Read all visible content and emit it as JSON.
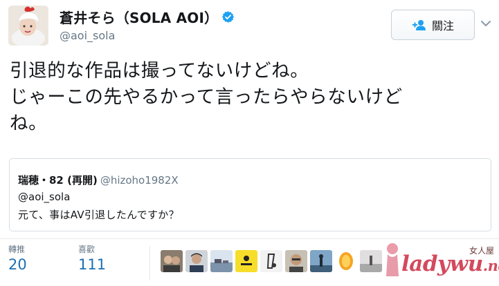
{
  "user": {
    "display_name": "蒼井そら（SOLA AOI）",
    "handle": "@aoi_sola",
    "verified_icon": "verified-badge-icon",
    "avatar_icon": "profile-avatar"
  },
  "follow": {
    "label": "關注",
    "icon": "add-user-icon"
  },
  "tweet": {
    "lines": [
      "引退的な作品は撮ってないけどね。",
      "じゃーこの先やるかって言ったらやらないけど",
      "ね。"
    ]
  },
  "quote": {
    "name": "瑞穂・82 (再開)",
    "handle": "@hizoho1982X",
    "mention": "@aoi_sola",
    "text": "元て、事はAV引退したんですか？"
  },
  "stats": {
    "retweets_label": "轉推",
    "retweets_count": "20",
    "likes_label": "喜歡",
    "likes_count": "111"
  },
  "watermark": {
    "top": "女人屋",
    "main": "ladywu",
    "suffix": ".net"
  },
  "colors": {
    "accent": "#1b6fb4",
    "verified": "#1da1f2",
    "muted": "#657786",
    "watermark": "#d34a5d"
  }
}
